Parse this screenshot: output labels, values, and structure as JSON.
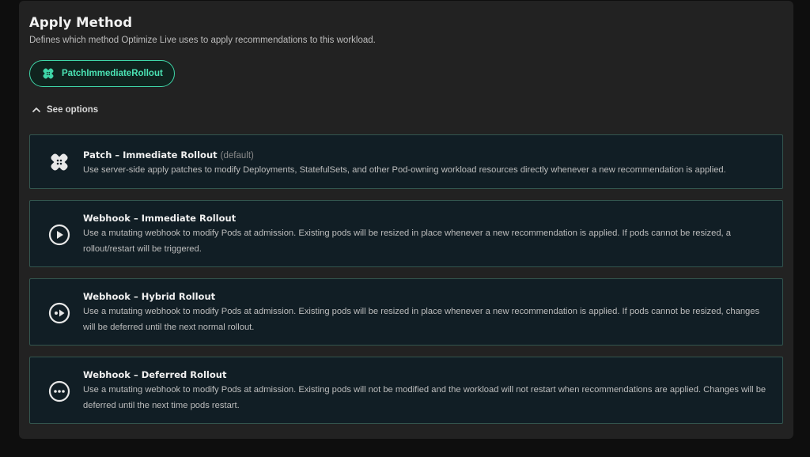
{
  "section": {
    "title": "Apply Method",
    "description": "Defines which method Optimize Live uses to apply recommendations to this workload."
  },
  "selected_method": {
    "label": "PatchImmediateRollout",
    "icon": "patch-icon",
    "accent_color": "#3fd6a8"
  },
  "toggle": {
    "label": "See options",
    "icon": "chevron-up-icon"
  },
  "options": [
    {
      "name": "Patch – Immediate Rollout",
      "tag": "(default)",
      "icon": "patch-icon",
      "body": "Use server-side apply patches to modify Deployments, StatefulSets, and other Pod-owning workload resources directly whenever a new recommendation is applied."
    },
    {
      "name": "Webhook – Immediate Rollout",
      "tag": "",
      "icon": "play-circle-icon",
      "body": "Use a mutating webhook to modify Pods at admission. Existing pods will be resized in place whenever a new recommendation is applied. If pods cannot be resized, a rollout/restart will be triggered."
    },
    {
      "name": "Webhook – Hybrid Rollout",
      "tag": "",
      "icon": "play-dot-circle-icon",
      "body": "Use a mutating webhook to modify Pods at admission. Existing pods will be resized in place whenever a new recommendation is applied. If pods cannot be resized, changes will be deferred until the next normal rollout."
    },
    {
      "name": "Webhook – Deferred Rollout",
      "tag": "",
      "icon": "ellipsis-circle-icon",
      "body": "Use a mutating webhook to modify Pods at admission. Existing pods will not be modified and the workload will not restart when recommendations are applied. Changes will be deferred until the next time pods restart."
    }
  ]
}
